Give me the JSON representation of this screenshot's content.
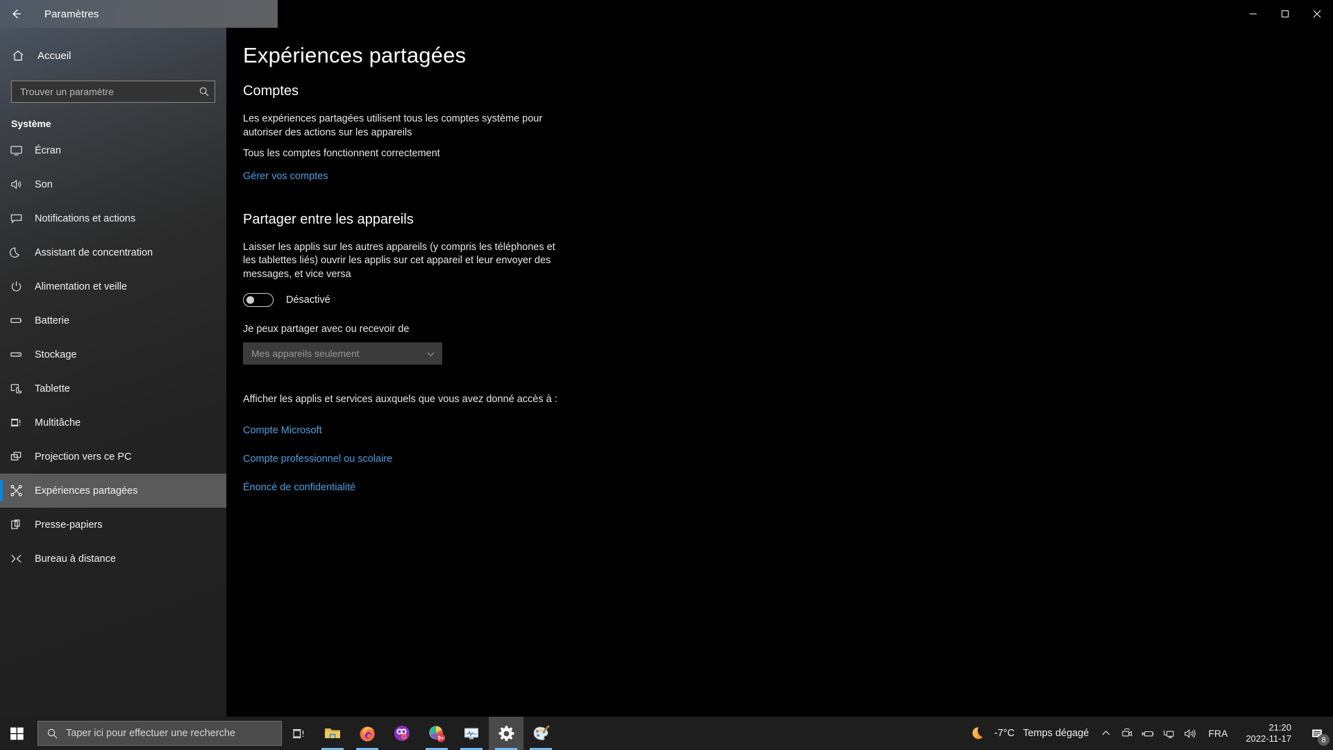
{
  "window": {
    "title": "Paramètres",
    "back_icon": "back-arrow-icon",
    "minimize_label": "Réduire",
    "maximize_label": "Agrandir",
    "close_label": "Fermer"
  },
  "sidebar": {
    "home_label": "Accueil",
    "search_placeholder": "Trouver un paramètre",
    "section_title": "Système",
    "items": [
      {
        "label": "Écran",
        "icon": "monitor-icon"
      },
      {
        "label": "Son",
        "icon": "speaker-icon"
      },
      {
        "label": "Notifications et actions",
        "icon": "notification-bubble-icon"
      },
      {
        "label": "Assistant de concentration",
        "icon": "moon-icon"
      },
      {
        "label": "Alimentation et veille",
        "icon": "power-icon"
      },
      {
        "label": "Batterie",
        "icon": "battery-icon"
      },
      {
        "label": "Stockage",
        "icon": "storage-drive-icon"
      },
      {
        "label": "Tablette",
        "icon": "tablet-touch-icon"
      },
      {
        "label": "Multitâche",
        "icon": "multitasking-icon"
      },
      {
        "label": "Projection vers ce PC",
        "icon": "projection-icon"
      },
      {
        "label": "Expériences partagées",
        "icon": "shared-nodes-icon",
        "selected": true
      },
      {
        "label": "Presse-papiers",
        "icon": "clipboard-icon"
      },
      {
        "label": "Bureau à distance",
        "icon": "remote-desktop-icon"
      }
    ]
  },
  "main": {
    "page_title": "Expériences partagées",
    "accounts": {
      "heading": "Comptes",
      "description": "Les expériences partagées utilisent tous les comptes système pour autoriser des actions sur les appareils",
      "status": "Tous les comptes fonctionnent correctement",
      "manage_link": "Gérer vos comptes"
    },
    "share": {
      "heading": "Partager entre les appareils",
      "description": "Laisser les applis sur les autres appareils (y compris les téléphones et les tablettes liés) ouvrir les applis sur cet appareil et leur envoyer des messages, et vice versa",
      "toggle_state": "Désactivé",
      "toggle_on": false,
      "dropdown_label": "Je peux partager avec ou recevoir de",
      "dropdown_value": "Mes appareils seulement",
      "dropdown_enabled": false
    },
    "access": {
      "description": "Afficher les applis et services auxquels que vous avez donné accès à :",
      "links": [
        "Compte Microsoft",
        "Compte professionnel ou scolaire"
      ],
      "privacy_link": "Énoncé de confidentialité"
    }
  },
  "taskbar": {
    "start_label": "Démarrer",
    "search_placeholder": "Taper ici pour effectuer une recherche",
    "task_view_label": "Affichage des tâches",
    "apps": [
      {
        "name": "file-explorer",
        "running": true,
        "active": false
      },
      {
        "name": "firefox",
        "running": true,
        "active": false
      },
      {
        "name": "messaging",
        "running": false,
        "active": false
      },
      {
        "name": "charts-app",
        "running": true,
        "active": false,
        "badge": "9+"
      },
      {
        "name": "system-monitor",
        "running": true,
        "active": false
      },
      {
        "name": "settings",
        "running": true,
        "active": true
      },
      {
        "name": "paint",
        "running": true,
        "active": false
      }
    ],
    "weather": {
      "temperature": "-7°C",
      "condition": "Temps dégagé",
      "icon": "crescent-moon-icon"
    },
    "tray_icons": [
      "chevron-up-icon",
      "camera-icon",
      "battery-charging-icon",
      "network-icon",
      "volume-icon"
    ],
    "language": "FRA",
    "clock_time": "21:20",
    "clock_date": "2022-11-17",
    "notification_count": "8"
  },
  "colors": {
    "accent": "#0a84e0",
    "link": "#4ca0e0",
    "taskbar_bg": "#1e1e1e",
    "selected_nav_bg": "#5a5a5a",
    "weather_icon": "#f5a623"
  }
}
